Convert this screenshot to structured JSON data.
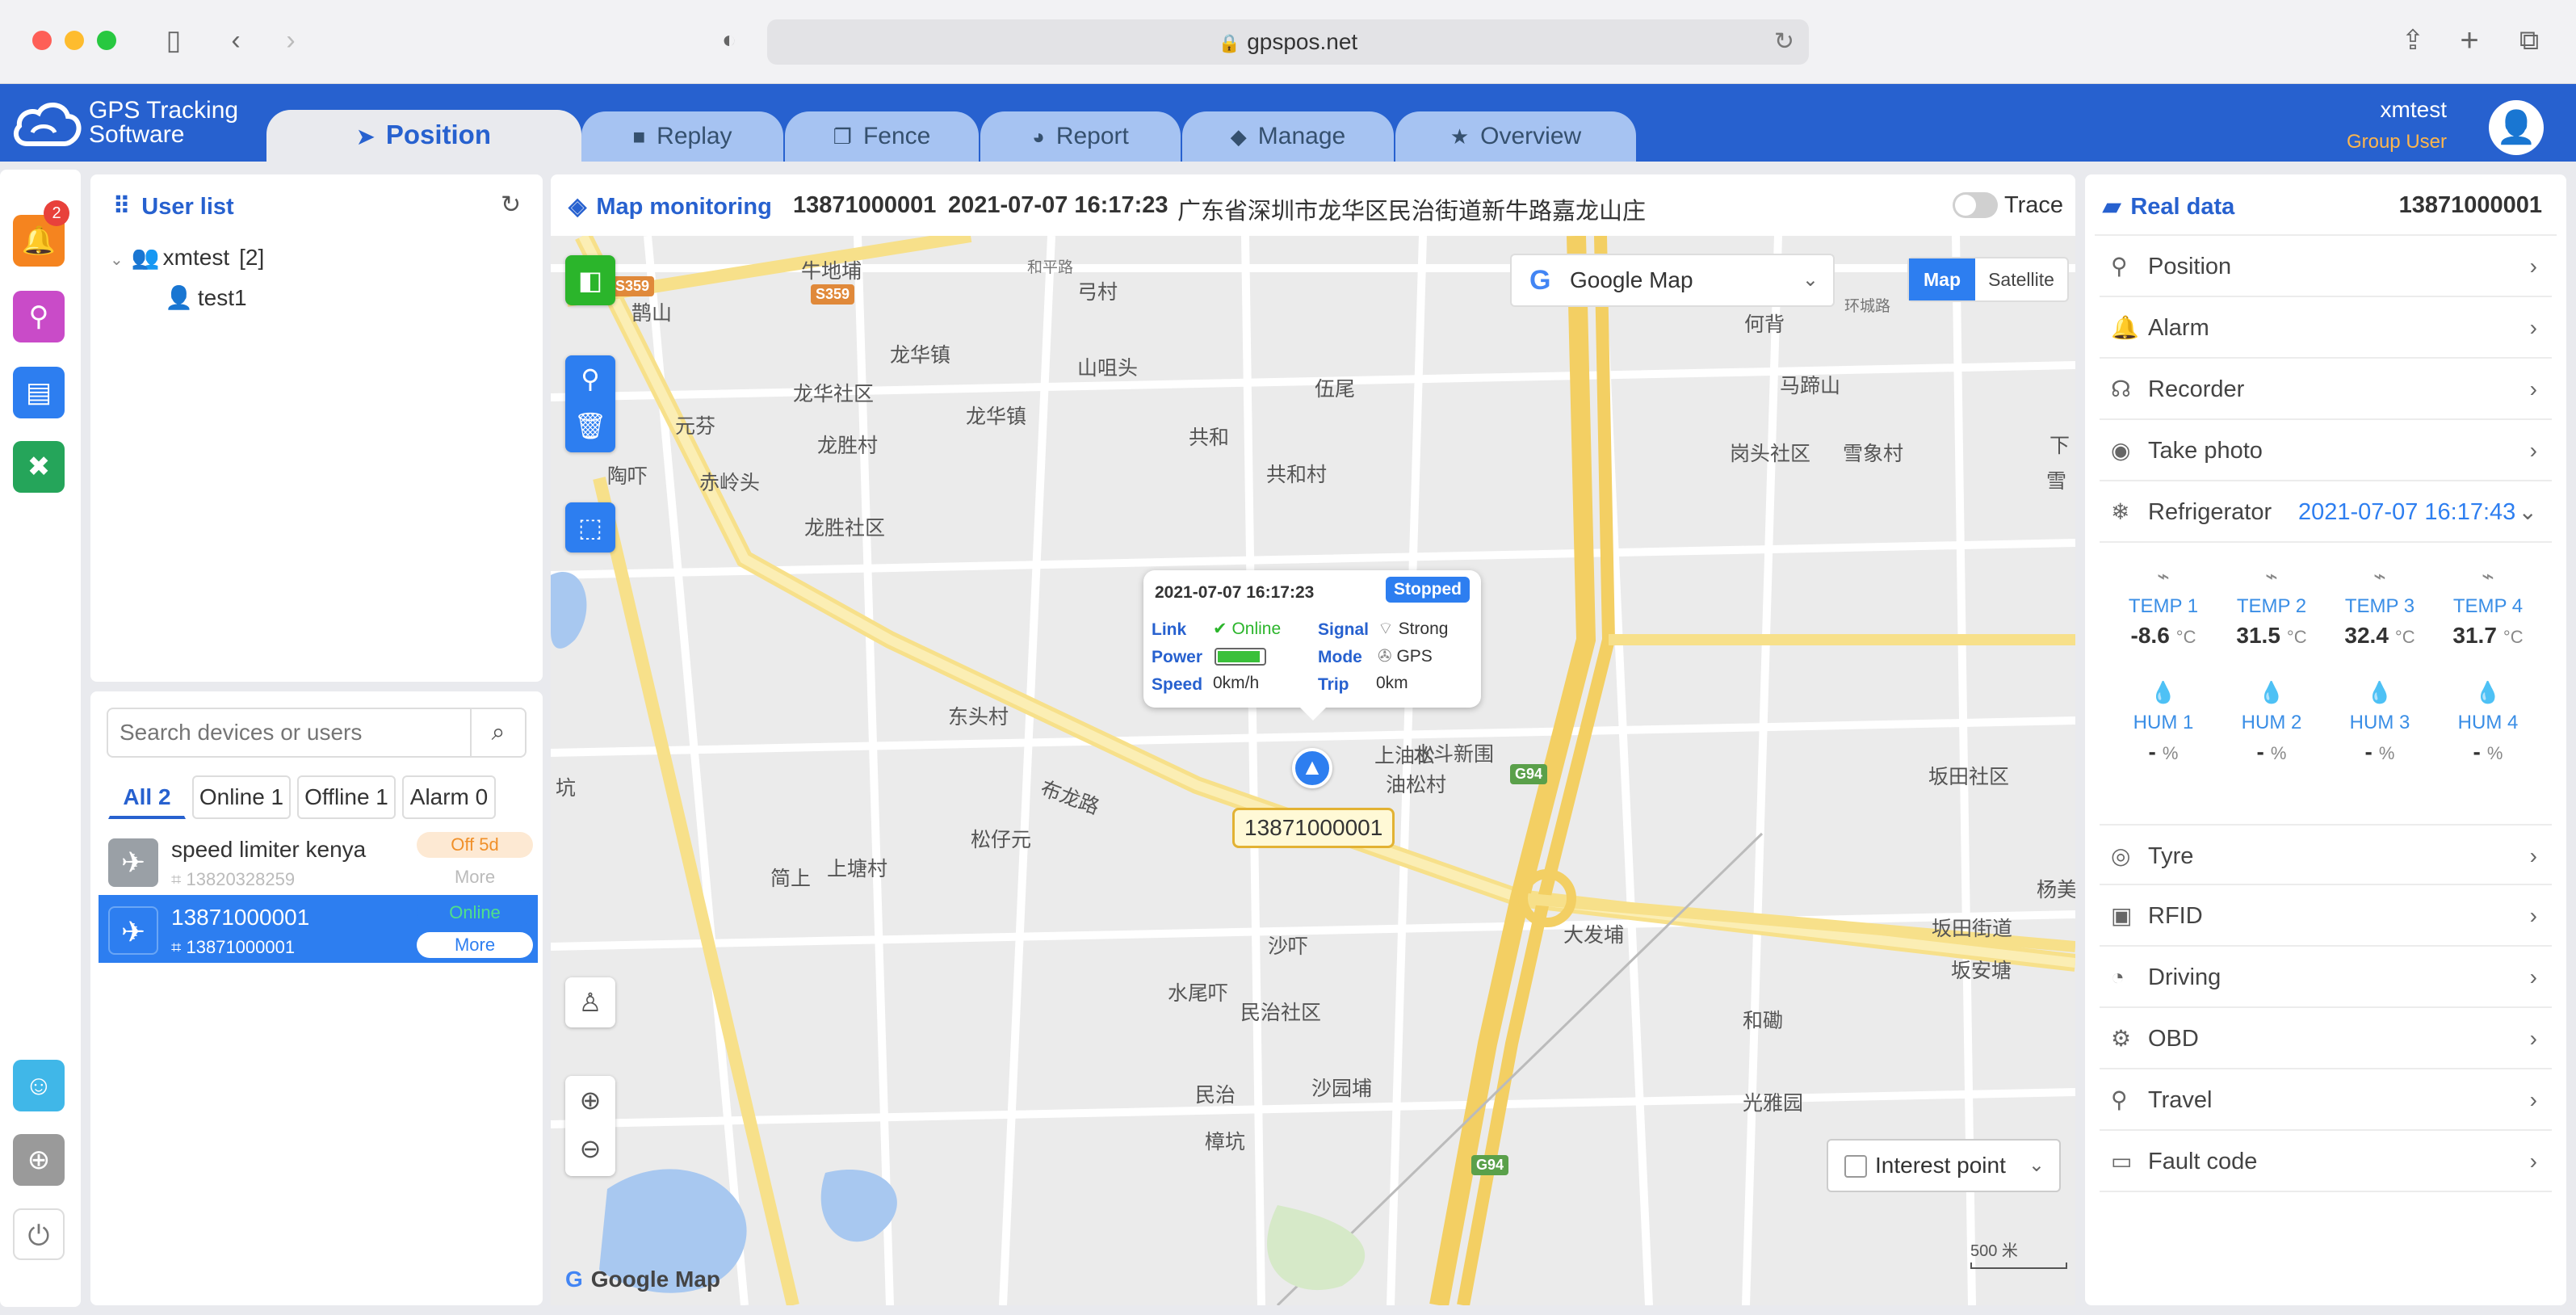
{
  "browser": {
    "url": "gpspos.net"
  },
  "app": {
    "brand_line1": "GPS Tracking",
    "brand_line2": "Software",
    "tabs": [
      {
        "label": "Position",
        "icon": "send-icon"
      },
      {
        "label": "Replay",
        "icon": "video-icon"
      },
      {
        "label": "Fence",
        "icon": "copy-icon"
      },
      {
        "label": "Report",
        "icon": "pie-chart-icon"
      },
      {
        "label": "Manage",
        "icon": "cube-icon"
      },
      {
        "label": "Overview",
        "icon": "star-icon"
      }
    ],
    "user": {
      "name": "xmtest",
      "role": "Group User"
    }
  },
  "rail": {
    "alarm_badge": "2",
    "colors": [
      "#f5841f",
      "#c94bc8",
      "#2d7ef0",
      "#25a55a",
      "#40b7e8",
      "#9a9a9a"
    ]
  },
  "user_list": {
    "title": "User list",
    "tree": [
      {
        "label": "xmtest",
        "count": "[2]"
      },
      {
        "label": "test1"
      }
    ],
    "search": {
      "placeholder": "Search devices or users"
    },
    "filters": [
      "All 2",
      "Online 1",
      "Offline 1",
      "Alarm 0"
    ],
    "devices": [
      {
        "name": "speed limiter kenya",
        "id": "13820328259",
        "status": "Off 5d",
        "more": "More"
      },
      {
        "name": "13871000001",
        "id": "13871000001",
        "status": "Online",
        "more": "More"
      }
    ]
  },
  "map_panel": {
    "title": "Map monitoring",
    "device_id": "13871000001",
    "datetime": "2021-07-07 16:17:23",
    "address": "广东省深圳市龙华区民治街道新牛路嘉龙山庄",
    "trace_label": "Trace",
    "map_type": "Google Map",
    "seg_map": "Map",
    "seg_satellite": "Satellite",
    "interest_point": "Interest point",
    "brand": "Google Map",
    "scale": "500 米",
    "popup": {
      "time": "2021-07-07 16:17:23",
      "state": "Stopped",
      "link_k": "Link",
      "link_v": "Online",
      "signal_k": "Signal",
      "signal_v": "Strong",
      "power_k": "Power",
      "mode_k": "Mode",
      "mode_v": "GPS",
      "speed_k": "Speed",
      "speed_v": "0km/h",
      "trip_k": "Trip",
      "trip_v": "0km"
    },
    "marker_label": "13871000001",
    "labels": [
      "牛地埔",
      "鹊山",
      "弓村",
      "和平路",
      "龙华镇",
      "山咀头",
      "伍尾",
      "何背",
      "环城路",
      "马蹄山",
      "龙华社区",
      "元芬",
      "龙华镇",
      "共和",
      "岗头社区",
      "雪象村",
      "龙胜村",
      "共和村",
      "陶吓",
      "赤岭头",
      "龙胜社区",
      "东头村",
      "水斗新围",
      "上油松",
      "油松村",
      "布龙路",
      "坂田社区",
      "松仔元",
      "上塘村",
      "简上",
      "大发埔",
      "坂田街道",
      "杨美",
      "沙吓",
      "水尾吓",
      "民治社区",
      "和磡",
      "坂安塘",
      "民治",
      "沙园埔",
      "光雅园",
      "樟坑",
      "坑",
      "下",
      "雪"
    ],
    "shields": [
      "S359",
      "S359",
      "G94",
      "G94"
    ]
  },
  "real_data": {
    "title": "Real data",
    "device_id": "13871000001",
    "rows_top": [
      "Position",
      "Alarm",
      "Recorder",
      "Take photo"
    ],
    "refrigerator": {
      "label": "Refrigerator",
      "time": "2021-07-07 16:17:43"
    },
    "temps": [
      {
        "label": "TEMP 1",
        "value": "-8.6",
        "unit": "°C"
      },
      {
        "label": "TEMP 2",
        "value": "31.5",
        "unit": "°C"
      },
      {
        "label": "TEMP 3",
        "value": "32.4",
        "unit": "°C"
      },
      {
        "label": "TEMP 4",
        "value": "31.7",
        "unit": "°C"
      }
    ],
    "hums": [
      {
        "label": "HUM 1",
        "value": "-",
        "unit": "%"
      },
      {
        "label": "HUM 2",
        "value": "-",
        "unit": "%"
      },
      {
        "label": "HUM 3",
        "value": "-",
        "unit": "%"
      },
      {
        "label": "HUM 4",
        "value": "-",
        "unit": "%"
      }
    ],
    "rows_bottom": [
      "Tyre",
      "RFID",
      "Driving",
      "OBD",
      "Travel",
      "Fault code"
    ]
  }
}
